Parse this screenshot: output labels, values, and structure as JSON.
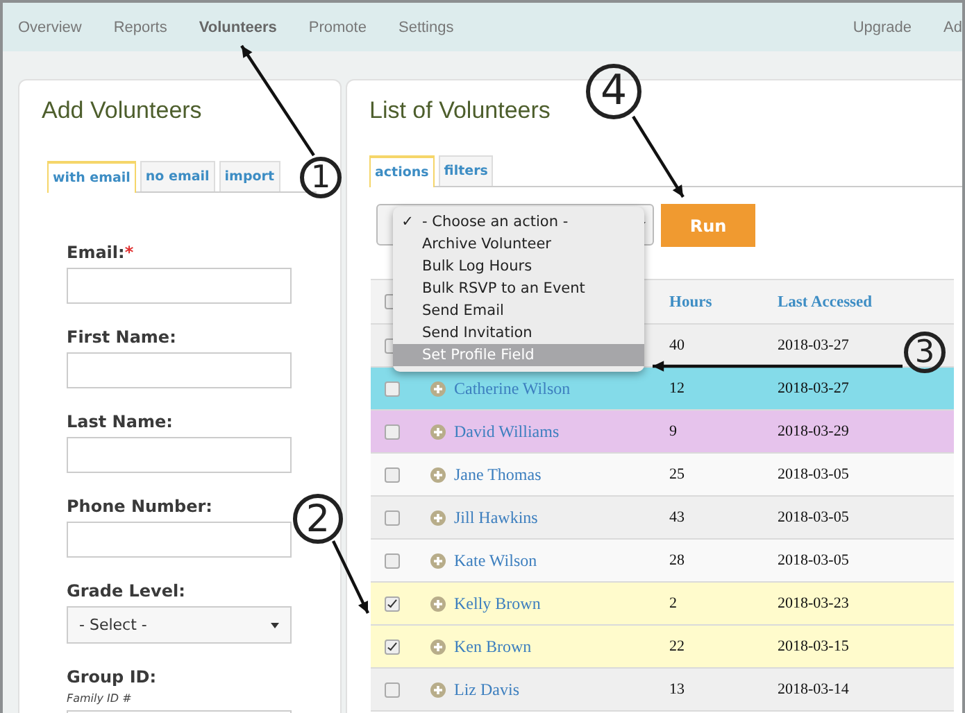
{
  "nav": {
    "items": [
      {
        "label": "Overview",
        "selected": false
      },
      {
        "label": "Reports",
        "selected": false
      },
      {
        "label": "Volunteers",
        "selected": true
      },
      {
        "label": "Promote",
        "selected": false
      },
      {
        "label": "Settings",
        "selected": false
      }
    ],
    "right_items": [
      "Upgrade",
      "Ad"
    ]
  },
  "add_panel": {
    "title": "Add Volunteers",
    "required_mark": "*",
    "tabs": [
      {
        "label": "with email",
        "selected": true
      },
      {
        "label": "no email",
        "selected": false
      },
      {
        "label": "import",
        "selected": false
      }
    ],
    "fields": [
      {
        "kind": "text",
        "label": "Email:",
        "required": true
      },
      {
        "kind": "text",
        "label": "First Name:",
        "required": false
      },
      {
        "kind": "text",
        "label": "Last Name:",
        "required": false
      },
      {
        "kind": "text",
        "label": "Phone Number:",
        "required": false
      },
      {
        "kind": "select",
        "label": "Grade Level:",
        "required": false,
        "value": "- Select -"
      },
      {
        "kind": "text",
        "label": "Group ID:",
        "required": false,
        "hint": "Family ID #"
      }
    ]
  },
  "list_panel": {
    "title": "List of Volunteers",
    "tabs": [
      {
        "label": "actions",
        "selected": true
      },
      {
        "label": "filters",
        "selected": false
      }
    ],
    "action_menu": {
      "items": [
        {
          "label": "- Choose an action -",
          "checked": true,
          "highlighted": false
        },
        {
          "label": "Archive Volunteer",
          "checked": false,
          "highlighted": false
        },
        {
          "label": "Bulk Log Hours",
          "checked": false,
          "highlighted": false
        },
        {
          "label": "Bulk RSVP to an Event",
          "checked": false,
          "highlighted": false
        },
        {
          "label": "Send Email",
          "checked": false,
          "highlighted": false
        },
        {
          "label": "Send Invitation",
          "checked": false,
          "highlighted": false
        },
        {
          "label": "Set Profile Field",
          "checked": false,
          "highlighted": true
        }
      ],
      "check_mark": "✓"
    },
    "run_button": "Run",
    "table": {
      "select_all_checked": false,
      "columns": [
        "Hours",
        "Last Accessed"
      ],
      "rows": [
        {
          "checked": false,
          "hours": "40",
          "last_accessed": "2018-03-27"
        },
        {
          "name": "Catherine Wilson",
          "checked": false,
          "hours": "12",
          "last_accessed": "2018-03-27",
          "color": "#84dbe9"
        },
        {
          "name": "David Williams",
          "checked": false,
          "hours": "9",
          "last_accessed": "2018-03-29",
          "color": "#e6c3ec"
        },
        {
          "name": "Jane Thomas",
          "checked": false,
          "hours": "25",
          "last_accessed": "2018-03-05"
        },
        {
          "name": "Jill Hawkins",
          "checked": false,
          "hours": "43",
          "last_accessed": "2018-03-05"
        },
        {
          "name": "Kate Wilson",
          "checked": false,
          "hours": "28",
          "last_accessed": "2018-03-05"
        },
        {
          "name": "Kelly Brown",
          "checked": true,
          "hours": "2",
          "last_accessed": "2018-03-23"
        },
        {
          "name": "Ken Brown",
          "checked": true,
          "hours": "22",
          "last_accessed": "2018-03-15"
        },
        {
          "name": "Liz Davis",
          "checked": false,
          "hours": "13",
          "last_accessed": "2018-03-14"
        }
      ]
    }
  },
  "callouts": [
    {
      "number": "1"
    },
    {
      "number": "2"
    },
    {
      "number": "3"
    },
    {
      "number": "4"
    }
  ]
}
